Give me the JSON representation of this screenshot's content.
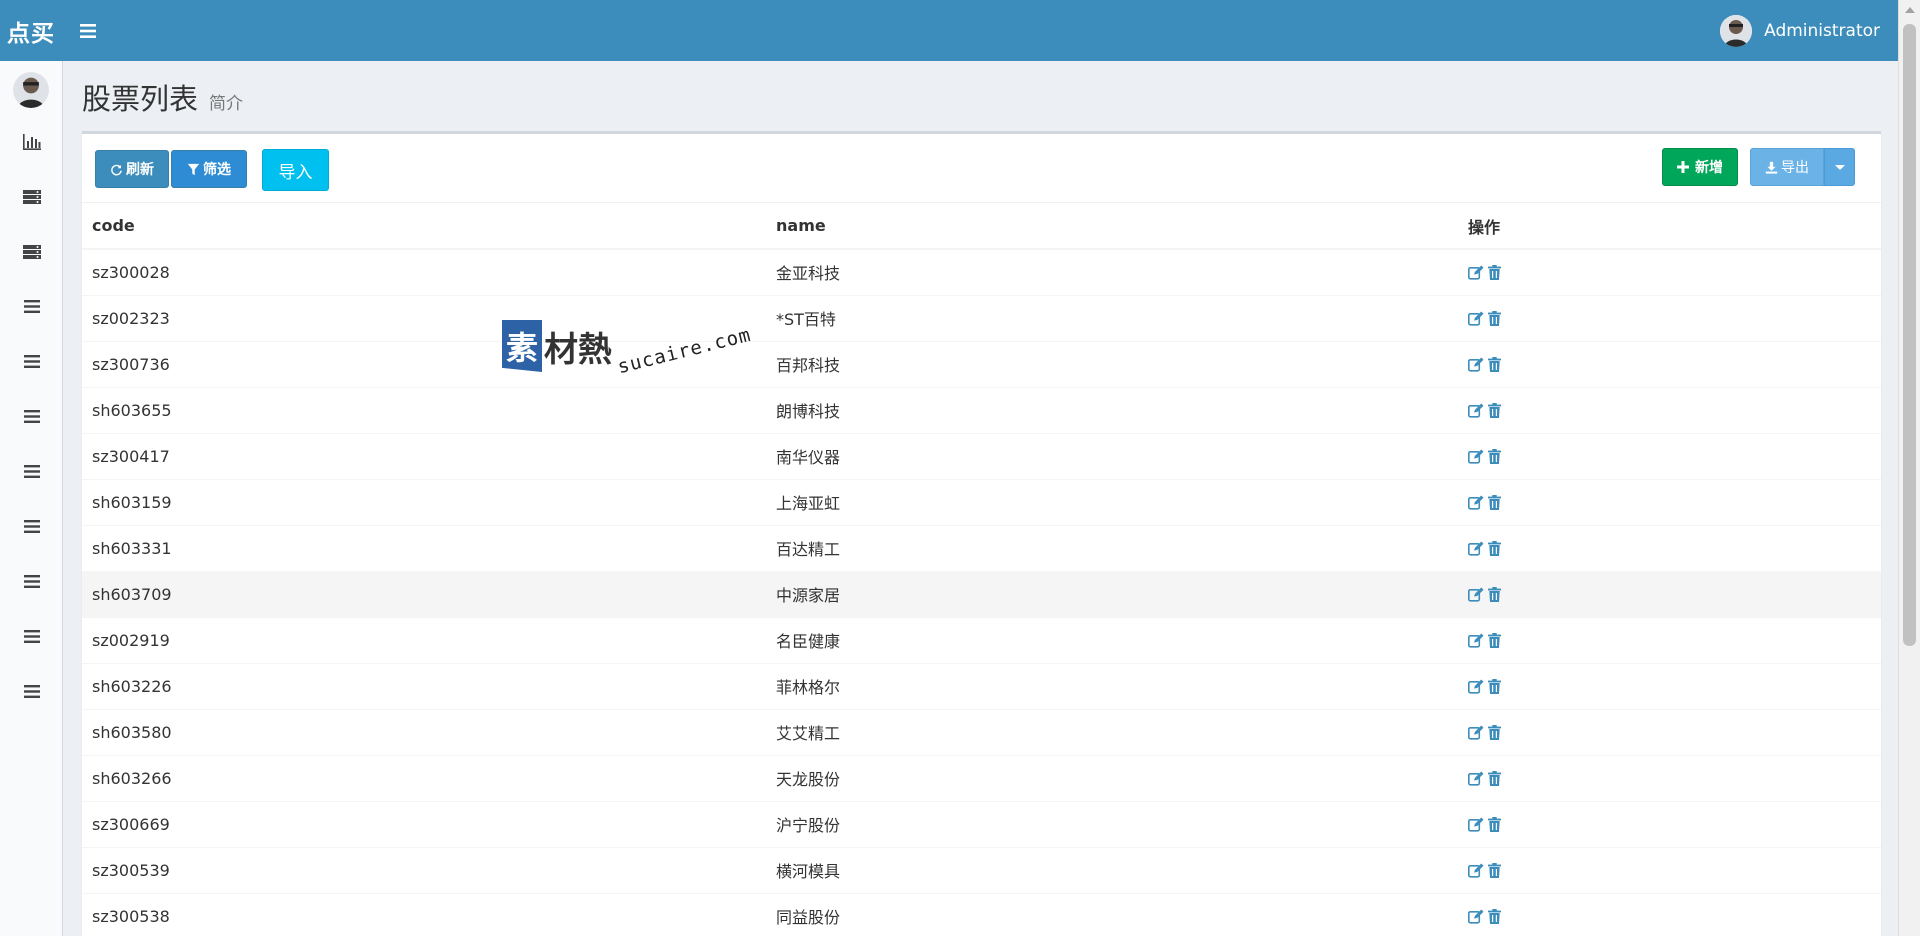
{
  "app": {
    "logo_text": "点买",
    "user_name": "Administrator"
  },
  "colors": {
    "header": "#3c8dbc",
    "sidebar": "#f9fafc",
    "btn_primary": "#3c8dbc",
    "btn_info": "#00c0ef",
    "btn_success": "#00a65a",
    "btn_export": "#6bb3e6",
    "op_icon": "#3c8dbc"
  },
  "sidebar": {
    "items": [
      {
        "icon": "bar-chart-icon"
      },
      {
        "icon": "server-icon"
      },
      {
        "icon": "server-icon"
      },
      {
        "icon": "list-icon"
      },
      {
        "icon": "list-icon"
      },
      {
        "icon": "list-icon"
      },
      {
        "icon": "list-icon"
      },
      {
        "icon": "list-icon"
      },
      {
        "icon": "list-icon"
      },
      {
        "icon": "list-icon"
      },
      {
        "icon": "list-icon"
      }
    ]
  },
  "page": {
    "title": "股票列表",
    "subtitle": "简介"
  },
  "toolbar": {
    "refresh_label": "刷新",
    "filter_label": "筛选",
    "import_label": "导入",
    "add_label": "新增",
    "export_label": "导出"
  },
  "table": {
    "headers": {
      "code": "code",
      "name": "name",
      "ops": "操作"
    },
    "rows": [
      {
        "code": "sz300028",
        "name": "金亚科技"
      },
      {
        "code": "sz002323",
        "name": "*ST百特"
      },
      {
        "code": "sz300736",
        "name": "百邦科技"
      },
      {
        "code": "sh603655",
        "name": "朗博科技"
      },
      {
        "code": "sz300417",
        "name": "南华仪器"
      },
      {
        "code": "sh603159",
        "name": "上海亚虹"
      },
      {
        "code": "sh603331",
        "name": "百达精工"
      },
      {
        "code": "sh603709",
        "name": "中源家居"
      },
      {
        "code": "sz002919",
        "name": "名臣健康"
      },
      {
        "code": "sh603226",
        "name": "菲林格尔"
      },
      {
        "code": "sh603580",
        "name": "艾艾精工"
      },
      {
        "code": "sh603266",
        "name": "天龙股份"
      },
      {
        "code": "sz300669",
        "name": "沪宁股份"
      },
      {
        "code": "sz300539",
        "name": "横河模具"
      },
      {
        "code": "sz300538",
        "name": "同益股份"
      }
    ]
  },
  "watermark": {
    "badge": "素",
    "text": "材熱",
    "url": "sucaire.com"
  }
}
